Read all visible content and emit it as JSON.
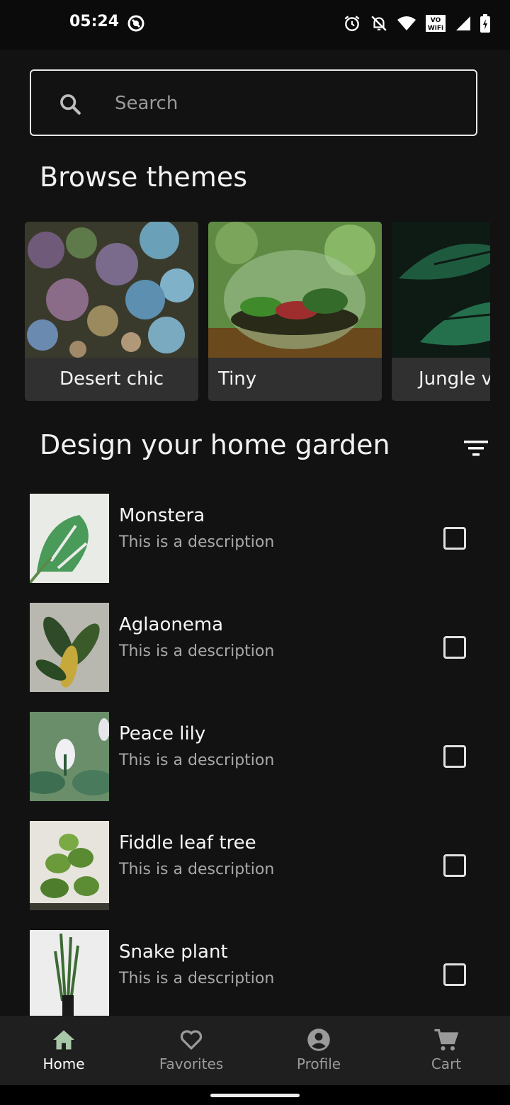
{
  "status_bar": {
    "time": "05:24",
    "icons": [
      "app-circle-icon",
      "alarm-icon",
      "mute-icon",
      "wifi-icon",
      "vowifi-icon",
      "signal-icon",
      "battery-icon"
    ],
    "vowifi_top": "VO",
    "vowifi_bottom": "WiFi"
  },
  "search": {
    "placeholder": "Search"
  },
  "themes": {
    "title": "Browse themes",
    "items": [
      {
        "label": "Desert chic"
      },
      {
        "label": "Tiny"
      },
      {
        "label": "Jungle vibes"
      }
    ]
  },
  "garden": {
    "title": "Design your home garden",
    "items": [
      {
        "name": "Monstera",
        "description": "This is a description",
        "checked": false
      },
      {
        "name": "Aglaonema",
        "description": "This is a description",
        "checked": false
      },
      {
        "name": "Peace lily",
        "description": "This is a description",
        "checked": false
      },
      {
        "name": "Fiddle leaf tree",
        "description": "This is a description",
        "checked": false
      },
      {
        "name": "Snake plant",
        "description": "This is a description",
        "checked": false
      }
    ]
  },
  "bottom_nav": {
    "items": [
      {
        "label": "Home",
        "icon": "home-icon",
        "active": true
      },
      {
        "label": "Favorites",
        "icon": "heart-icon",
        "active": false
      },
      {
        "label": "Profile",
        "icon": "account-circle-icon",
        "active": false
      },
      {
        "label": "Cart",
        "icon": "cart-icon",
        "active": false
      }
    ]
  },
  "colors": {
    "background": "#121212",
    "surface": "#303030",
    "nav_active_icon": "#a8c7a8",
    "inactive": "#9a9a9a"
  }
}
